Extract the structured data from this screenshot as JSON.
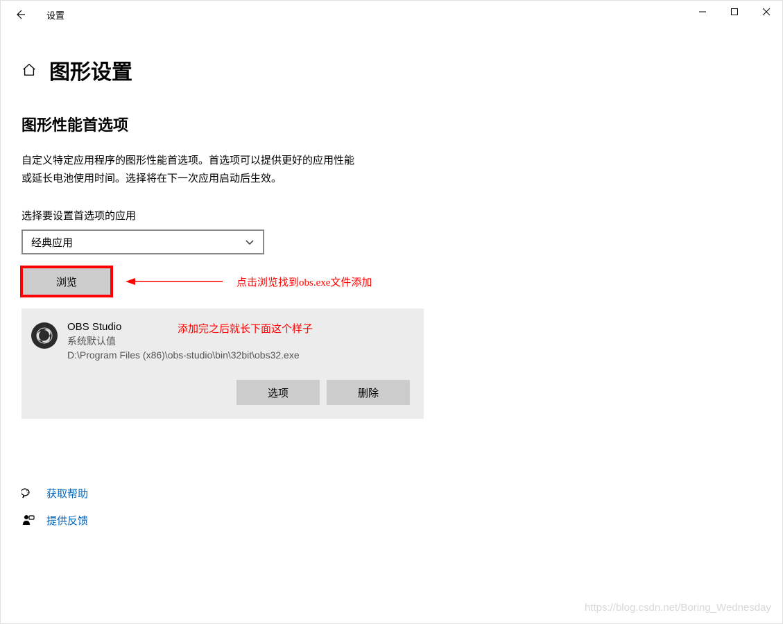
{
  "window": {
    "title": "设置"
  },
  "page": {
    "title": "图形设置",
    "section_title": "图形性能首选项",
    "description_line1": "自定义特定应用程序的图形性能首选项。首选项可以提供更好的应用性能",
    "description_line2": "或延长电池使用时间。选择将在下一次应用启动后生效。",
    "select_label": "选择要设置首选项的应用",
    "dropdown_value": "经典应用",
    "browse_label": "浏览",
    "options_label": "选项",
    "delete_label": "删除"
  },
  "annotations": {
    "browse_hint": "点击浏览找到obs.exe文件添加",
    "added_hint": "添加完之后就长下面这个样子"
  },
  "app": {
    "name": "OBS Studio",
    "default_text": "系统默认值",
    "path": "D:\\Program Files (x86)\\obs-studio\\bin\\32bit\\obs32.exe"
  },
  "footer": {
    "help": "获取帮助",
    "feedback": "提供反馈"
  },
  "watermark": "https://blog.csdn.net/Boring_Wednesday"
}
